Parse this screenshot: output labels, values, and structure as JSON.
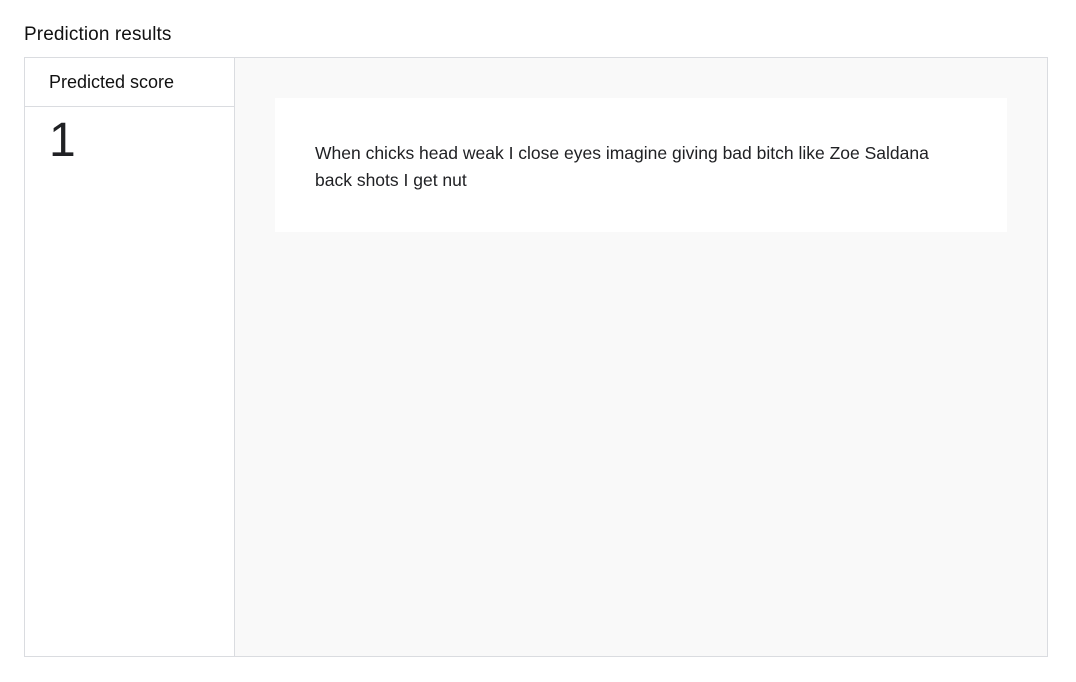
{
  "page": {
    "title": "Prediction results"
  },
  "results": {
    "score_header": "Predicted score",
    "score_value": "1",
    "input_text": "When chicks head weak I close eyes imagine giving bad bitch like Zoe Saldana back shots I get nut"
  },
  "colors": {
    "border": "#dadce0",
    "text_area_background": "#f9f9f9",
    "card_background": "#ffffff",
    "text": "#202124"
  }
}
